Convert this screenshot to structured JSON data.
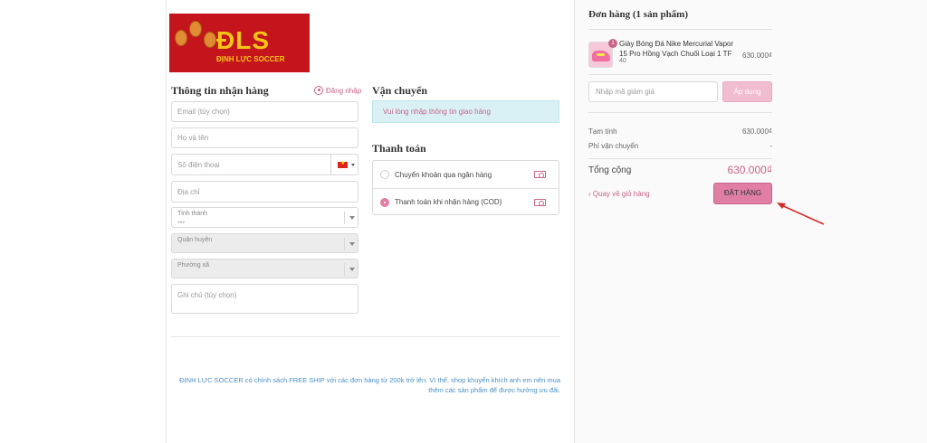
{
  "brand": {
    "logo_text": "ĐLS",
    "logo_subtext": "ĐỊNH LỰC SOCCER"
  },
  "shipping_info": {
    "title": "Thông tin nhận hàng",
    "login_label": "Đăng nhập",
    "email_placeholder": "Email (tùy chọn)",
    "name_placeholder": "Họ và tên",
    "phone_placeholder": "Số điện thoại",
    "address_placeholder": "Địa chỉ",
    "province_label": "Tỉnh thành",
    "province_value": "---",
    "district_label": "Quận huyện",
    "ward_label": "Phường xã",
    "note_placeholder": "Ghi chú (tùy chọn)"
  },
  "delivery": {
    "title": "Vận chuyển",
    "notice": "Vui lòng nhập thông tin giao hàng"
  },
  "payment": {
    "title": "Thanh toán",
    "options": [
      {
        "label": "Chuyển khoản qua ngân hàng",
        "selected": false
      },
      {
        "label": "Thanh toán khi nhận hàng (COD)",
        "selected": true
      }
    ]
  },
  "footer_note": "ĐỊNH LỰC SOCCER có chính sách FREE SHIP với các đơn hàng từ 200k trở lên. Vì thế, shop khuyến khích anh em nên mua thêm các sản phẩm để được hưởng ưu đãi.",
  "order": {
    "title": "Đơn hàng (1 sản phẩm)",
    "item": {
      "quantity": "1",
      "name": "Giày Bóng Đá Nike Mercurial Vapor 15 Pro Hồng Vạch Chuối Loại 1 TF",
      "variant": "40",
      "price": "630.000₫"
    },
    "discount_placeholder": "Nhập mã giảm giá",
    "apply_label": "Áp dụng",
    "subtotal_label": "Tạm tính",
    "subtotal_value": "630.000₫",
    "shipping_label": "Phí vận chuyển",
    "shipping_value": "-",
    "total_label": "Tổng cộng",
    "total_value": "630.000₫",
    "back_label": "Quay về giỏ hàng",
    "place_order_label": "ĐẶT HÀNG"
  },
  "colors": {
    "accent": "#e07fa3",
    "accent_text": "#c8638a",
    "notice_bg": "#d9f1f5",
    "footer_link": "#4a8fc2",
    "logo_bg": "#c4151c",
    "annotation_arrow": "#d42a2a"
  }
}
